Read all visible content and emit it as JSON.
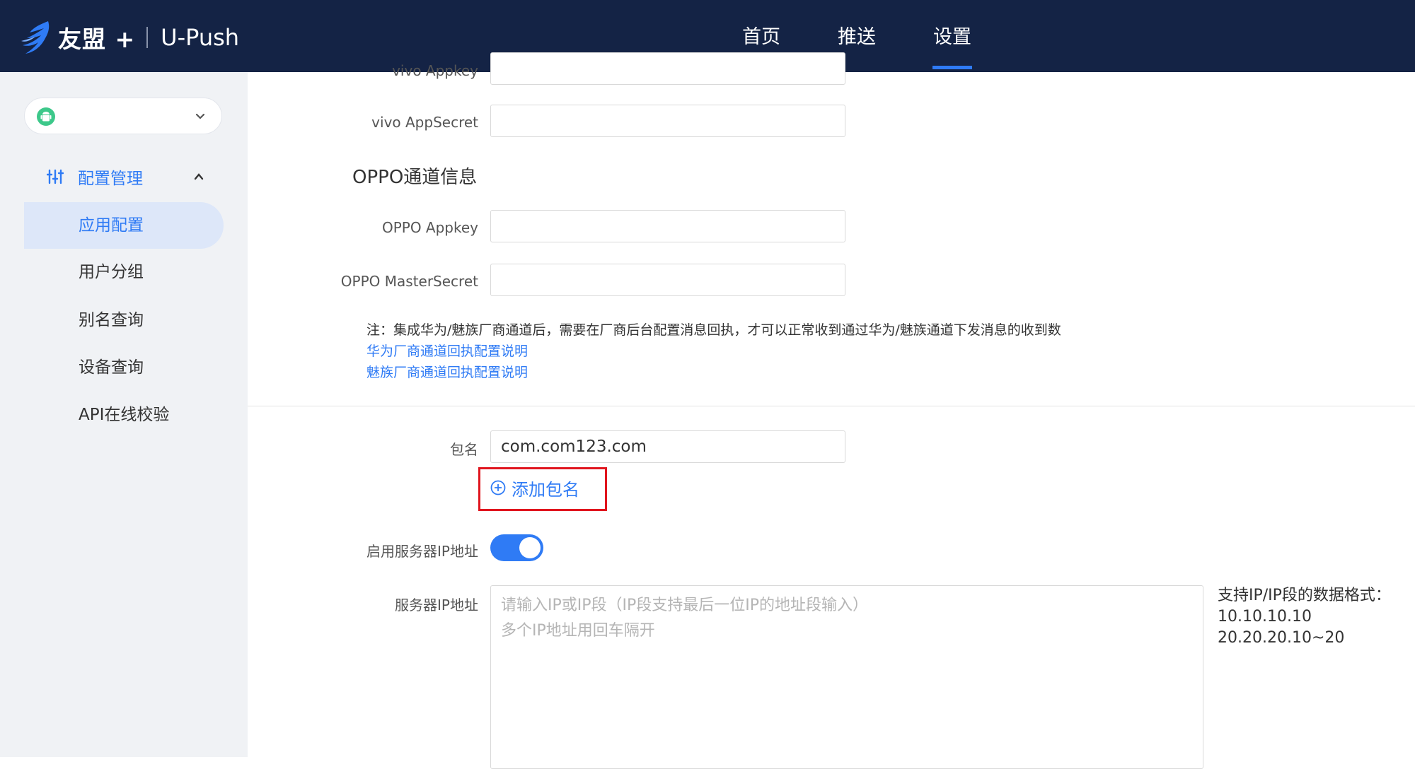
{
  "header": {
    "brand": "友盟 +",
    "product": "U-Push",
    "nav": [
      {
        "label": "首页",
        "active": false
      },
      {
        "label": "推送",
        "active": false
      },
      {
        "label": "设置",
        "active": true
      }
    ],
    "accent": "#2f7bf5",
    "background": "#142345"
  },
  "sidebar": {
    "app_select": {
      "icon": "android-icon",
      "value": ""
    },
    "group": {
      "label": "配置管理",
      "icon": "sliders-icon",
      "expanded": true
    },
    "items": [
      {
        "label": "应用配置",
        "active": true
      },
      {
        "label": "用户分组",
        "active": false
      },
      {
        "label": "别名查询",
        "active": false
      },
      {
        "label": "设备查询",
        "active": false
      },
      {
        "label": "API在线校验",
        "active": false
      }
    ]
  },
  "form": {
    "vivo_appkey_label": "vivo Appkey",
    "vivo_appsecret_label": "vivo AppSecret",
    "oppo_section_title": "OPPO通道信息",
    "oppo_appkey_label": "OPPO Appkey",
    "oppo_mastersecret_label": "OPPO MasterSecret",
    "note": "注：集成华为/魅族厂商通道后，需要在厂商后台配置消息回执，才可以正常收到通过华为/魅族通道下发消息的收到数",
    "huawei_link": "华为厂商通道回执配置说明",
    "meizu_link": "魅族厂商通道回执配置说明",
    "package_label": "包名",
    "package_value": "com.com123.com",
    "add_package": "添加包名",
    "enable_ip_label": "启用服务器IP地址",
    "enable_ip_on": true,
    "server_ip_label": "服务器IP地址",
    "server_ip_placeholder_line1": "请输入IP或IP段（IP段支持最后一位IP的地址段输入）",
    "server_ip_placeholder_line2": "多个IP地址用回车隔开",
    "hint_title": "支持IP/IP段的数据格式：",
    "hint_example1": "10.10.10.10",
    "hint_example2": "20.20.20.10~20"
  }
}
